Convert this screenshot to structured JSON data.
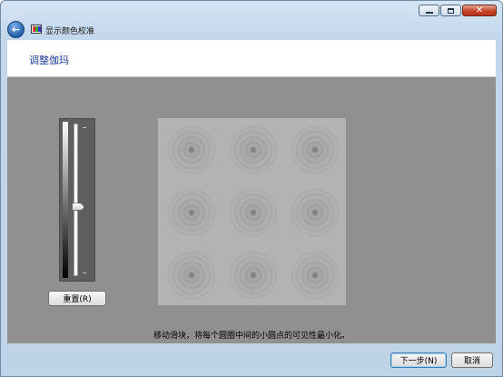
{
  "window": {
    "title": "显示颜色校准",
    "controls": {
      "minimize_icon": "minimize-icon",
      "maximize_icon": "maximize-icon",
      "close_icon": "close-icon",
      "close_glyph": "✕"
    }
  },
  "nav": {
    "back_glyph": "←"
  },
  "header": {
    "title": "调整伽玛"
  },
  "gamma_slider": {
    "value_fraction": 0.55
  },
  "reset_button": {
    "label": "重置(R)"
  },
  "pattern": {
    "rows": 3,
    "columns": 3,
    "colors": {
      "background": "#b3b3b3",
      "dot": "#7d7d7d"
    }
  },
  "instruction": "移动滑块，将每个圆圈中间的小圆点的可见性最小化。",
  "footer": {
    "next_label": "下一步(N)",
    "cancel_label": "取消"
  },
  "colors": {
    "content_bg": "#909090",
    "title_accent": "#1f3d9b"
  }
}
